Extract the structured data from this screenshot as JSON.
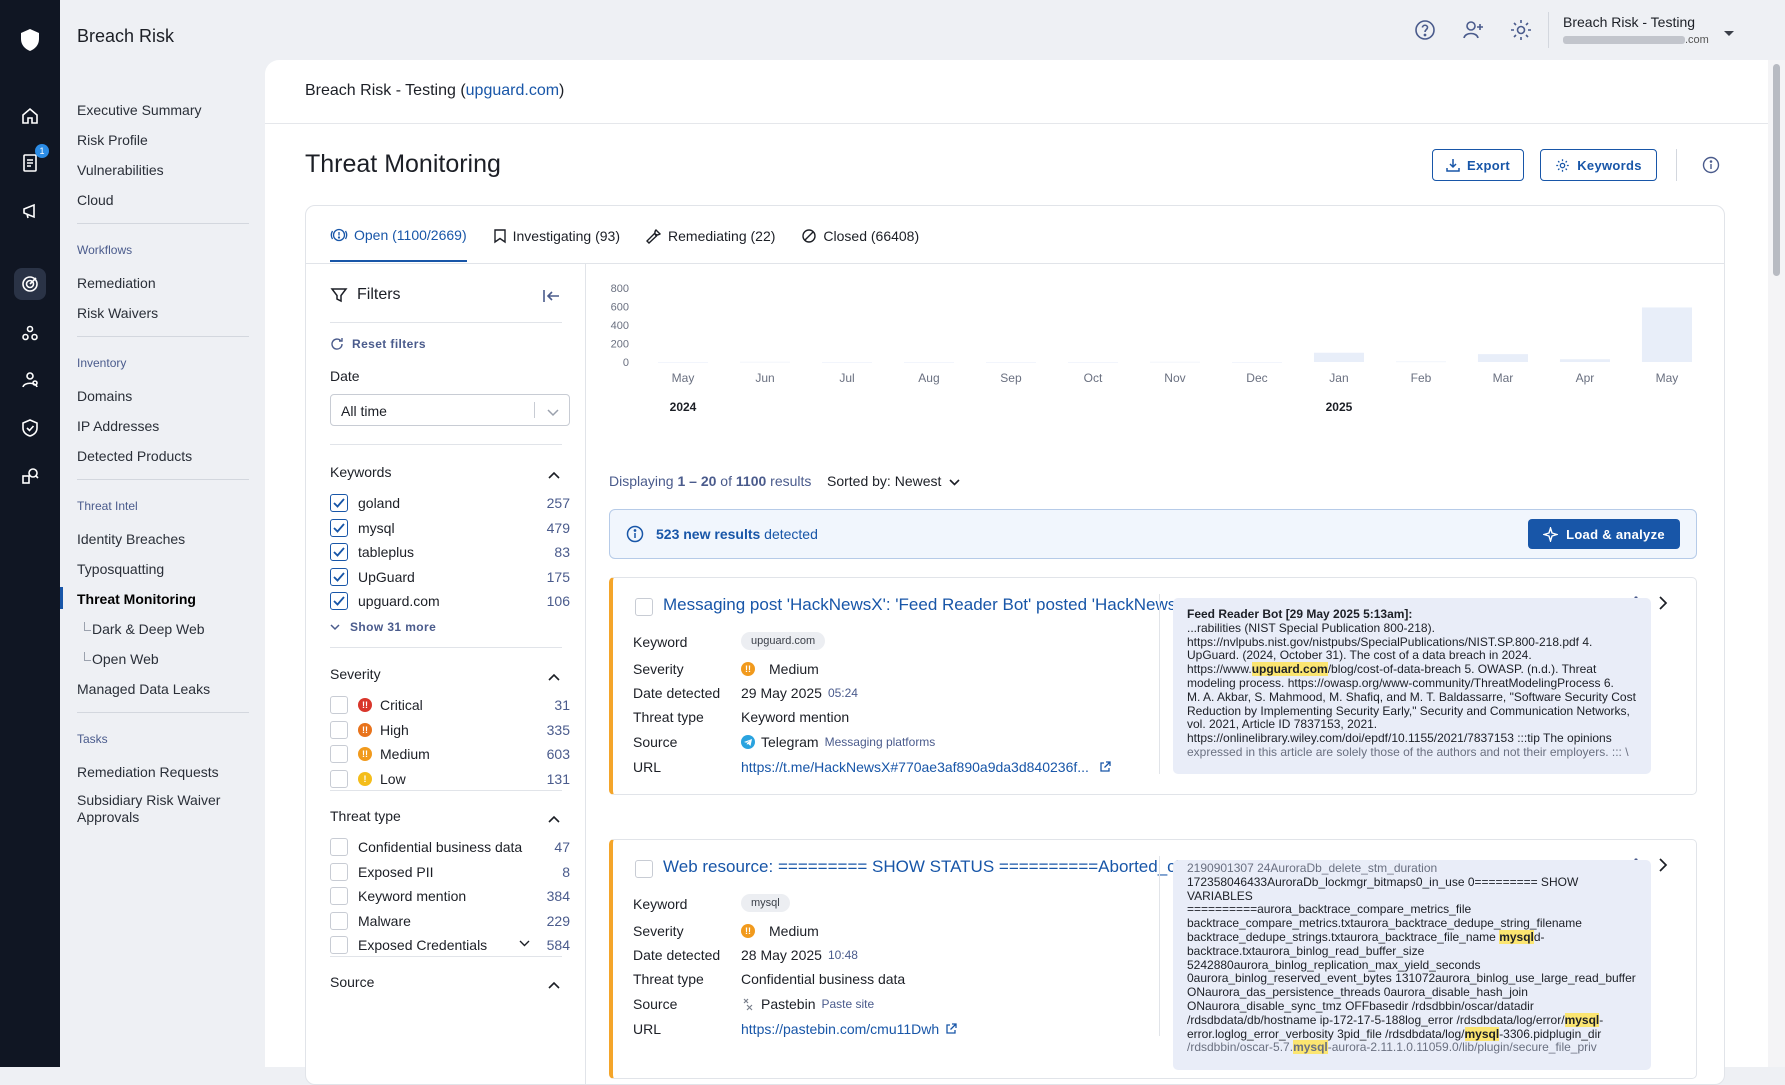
{
  "app": {
    "name": "Breach Risk"
  },
  "rail": {
    "badge_count": "1"
  },
  "sidebar": {
    "top_items": [
      "Executive Summary",
      "Risk Profile",
      "Vulnerabilities",
      "Cloud"
    ],
    "workflows_title": "Workflows",
    "workflows": [
      "Remediation",
      "Risk Waivers"
    ],
    "inventory_title": "Inventory",
    "inventory": [
      "Domains",
      "IP Addresses",
      "Detected Products"
    ],
    "intel_title": "Threat Intel",
    "intel": [
      "Identity Breaches",
      "Typosquatting",
      "Threat Monitoring"
    ],
    "intel_sub": [
      "Dark & Deep Web",
      "Open Web"
    ],
    "intel_after": "Managed Data Leaks",
    "tasks_title": "Tasks",
    "tasks": [
      "Remediation Requests",
      "Subsidiary Risk Waiver",
      "Approvals"
    ]
  },
  "topbar": {
    "org_name": "Breach Risk - Testing",
    "email_suffix": ".com"
  },
  "breadcrumb": {
    "org": "Breach Risk - Testing (",
    "domain": "upguard.com",
    "close": ")"
  },
  "page": {
    "title": "Threat Monitoring",
    "export_label": "Export",
    "keywords_label": "Keywords"
  },
  "tabs": [
    {
      "label": "Open (1100/2669)"
    },
    {
      "label": "Investigating (93)"
    },
    {
      "label": "Remediating (22)"
    },
    {
      "label": "Closed (66408)"
    }
  ],
  "filters": {
    "title": "Filters",
    "reset_label": "Reset filters",
    "date_label": "Date",
    "date_value": "All time",
    "keywords_title": "Keywords",
    "keywords": [
      {
        "label": "goland",
        "count": "257",
        "checked": true
      },
      {
        "label": "mysql",
        "count": "479",
        "checked": true
      },
      {
        "label": "tableplus",
        "count": "83",
        "checked": true
      },
      {
        "label": "UpGuard",
        "count": "175",
        "checked": true
      },
      {
        "label": "upguard.com",
        "count": "106",
        "checked": true
      }
    ],
    "show_more": "Show 31 more",
    "severity_title": "Severity",
    "severity": [
      {
        "label": "Critical",
        "count": "31",
        "color": "#d9362b"
      },
      {
        "label": "High",
        "count": "335",
        "color": "#e8731c"
      },
      {
        "label": "Medium",
        "count": "603",
        "color": "#f19a1d"
      },
      {
        "label": "Low",
        "count": "131",
        "color": "#f4bd1a"
      }
    ],
    "threat_type_title": "Threat type",
    "threat_types": [
      {
        "label": "Confidential business data",
        "count": "47"
      },
      {
        "label": "Exposed PII",
        "count": "8"
      },
      {
        "label": "Keyword mention",
        "count": "384"
      },
      {
        "label": "Malware",
        "count": "229"
      },
      {
        "label": "Exposed Credentials",
        "count": "584"
      }
    ],
    "source_title": "Source"
  },
  "chart_data": {
    "type": "bar",
    "categories": [
      "May",
      "Jun",
      "Jul",
      "Aug",
      "Sep",
      "Oct",
      "Nov",
      "Dec",
      "Jan",
      "Feb",
      "Mar",
      "Apr",
      "May"
    ],
    "year_labels": [
      {
        "index": 0,
        "label": "2024"
      },
      {
        "index": 8,
        "label": "2025"
      }
    ],
    "values": [
      0,
      2,
      0,
      0,
      0,
      0,
      2,
      0,
      100,
      5,
      85,
      30,
      590
    ],
    "yticks": [
      "800",
      "600",
      "400",
      "200",
      "0"
    ],
    "ylim": [
      0,
      800
    ],
    "color": "#e8eef9"
  },
  "results": {
    "display_prefix": "Displaying ",
    "display_range": "1 – 20",
    "display_of": " of ",
    "display_total": "1100",
    "display_suffix": " results",
    "sorted_label": "Sorted by: ",
    "sorted_value": "Newest",
    "banner_count": "523 new results",
    "banner_suffix": " detected",
    "load_label": "Load & analyze",
    "field_labels": {
      "keyword": "Keyword",
      "severity": "Severity",
      "date": "Date detected",
      "type": "Threat type",
      "source": "Source",
      "url": "URL"
    },
    "items": [
      {
        "title": "Messaging post 'HackNewsX': 'Feed Reader Bot' posted 'HackNewsX'",
        "keyword": "upguard.com",
        "severity": "Medium",
        "date": "29 May 2025",
        "time": "05:24",
        "type": "Keyword mention",
        "source": "Telegram",
        "source_cat": "Messaging platforms",
        "url": "https://t.me/HackNewsX#770ae3af890a9da3d840236f...",
        "preview_head": "Feed Reader Bot    [29 May 2025 5:13am]:",
        "preview_1": "...rabilities (NIST Special Publication 800-218).",
        "preview_2": "https://nvlpubs.nist.gov/nistpubs/SpecialPublications/NIST.SP.800-218.pdf 4.",
        "preview_3": "UpGuard. (2024, October 31). The cost of a data breach in 2024.",
        "preview_4a": "https://www.",
        "preview_4h": "upguard.com",
        "preview_4b": "/blog/cost-of-data-breach 5. OWASP. (n.d.). Threat",
        "preview_5": "modeling process. https://owasp.org/www-community/ThreatModelingProcess 6.",
        "preview_6": "M. A. Akbar, S. Mahmood, M. Shafiq, and M. T. Baldassarre, \"Software Security Cost",
        "preview_7": "Reduction by Implementing Security Early,\" Security and Communication Networks,",
        "preview_8": "vol. 2021, Article ID 7837153, 2021.",
        "preview_9": "https://onlinelibrary.wiley.com/doi/epdf/10.1155/2021/7837153 :::tip The opinions",
        "preview_10": "expressed in this article are solely those of the authors and not their employers. ::: \\"
      },
      {
        "title": "Web resource: ========= SHOW STATUS ==========Aborted_clients ...",
        "keyword": "mysql",
        "severity": "Medium",
        "date": "28 May 2025",
        "time": "10:48",
        "type": "Confidential business data",
        "source": "Pastebin",
        "source_cat": "Paste site",
        "url": "https://pastebin.com/cmu11Dwh",
        "preview_0": "2190901307 24AuroraDb_delete_stm_duration",
        "preview_1": "172358046433AuroraDb_lockmgr_bitmaps0_in_use 0========= SHOW VARIABLES",
        "preview_2": "==========aurora_backtrace_compare_metrics_file",
        "preview_3": "backtrace_compare_metrics.txtaurora_backtrace_dedupe_string_filename",
        "preview_4a": "backtrace_dedupe_strings.txtaurora_backtrace_file_name ",
        "preview_4h": "mysql",
        "preview_4b": "d-",
        "preview_5": "backtrace.txtaurora_binlog_read_buffer_size",
        "preview_6": "5242880aurora_binlog_replication_max_yield_seconds",
        "preview_7": "0aurora_binlog_reserved_event_bytes 131072aurora_binlog_use_large_read_buffer",
        "preview_8": "ONaurora_das_persistence_threads 0aurora_disable_hash_join",
        "preview_9": "ONaurora_disable_sync_tmz OFFbasedir /rdsdbbin/oscar/datadir",
        "preview_10a": "/rdsdbdata/db/hostname ip-172-17-5-188log_error /rdsdbdata/log/error/",
        "preview_10h": "mysql",
        "preview_10b": "-",
        "preview_11a": "error.loglog_error_verbosity 3pid_file /rdsdbdata/log/",
        "preview_11h": "mysql",
        "preview_11b": "-3306.pidplugin_dir",
        "preview_12a": "/rdsdbbin/oscar-5.7.",
        "preview_12h": "mysql",
        "preview_12b": "-aurora-2.11.1.0.11059.0/lib/plugin/secure_file_priv"
      }
    ]
  }
}
